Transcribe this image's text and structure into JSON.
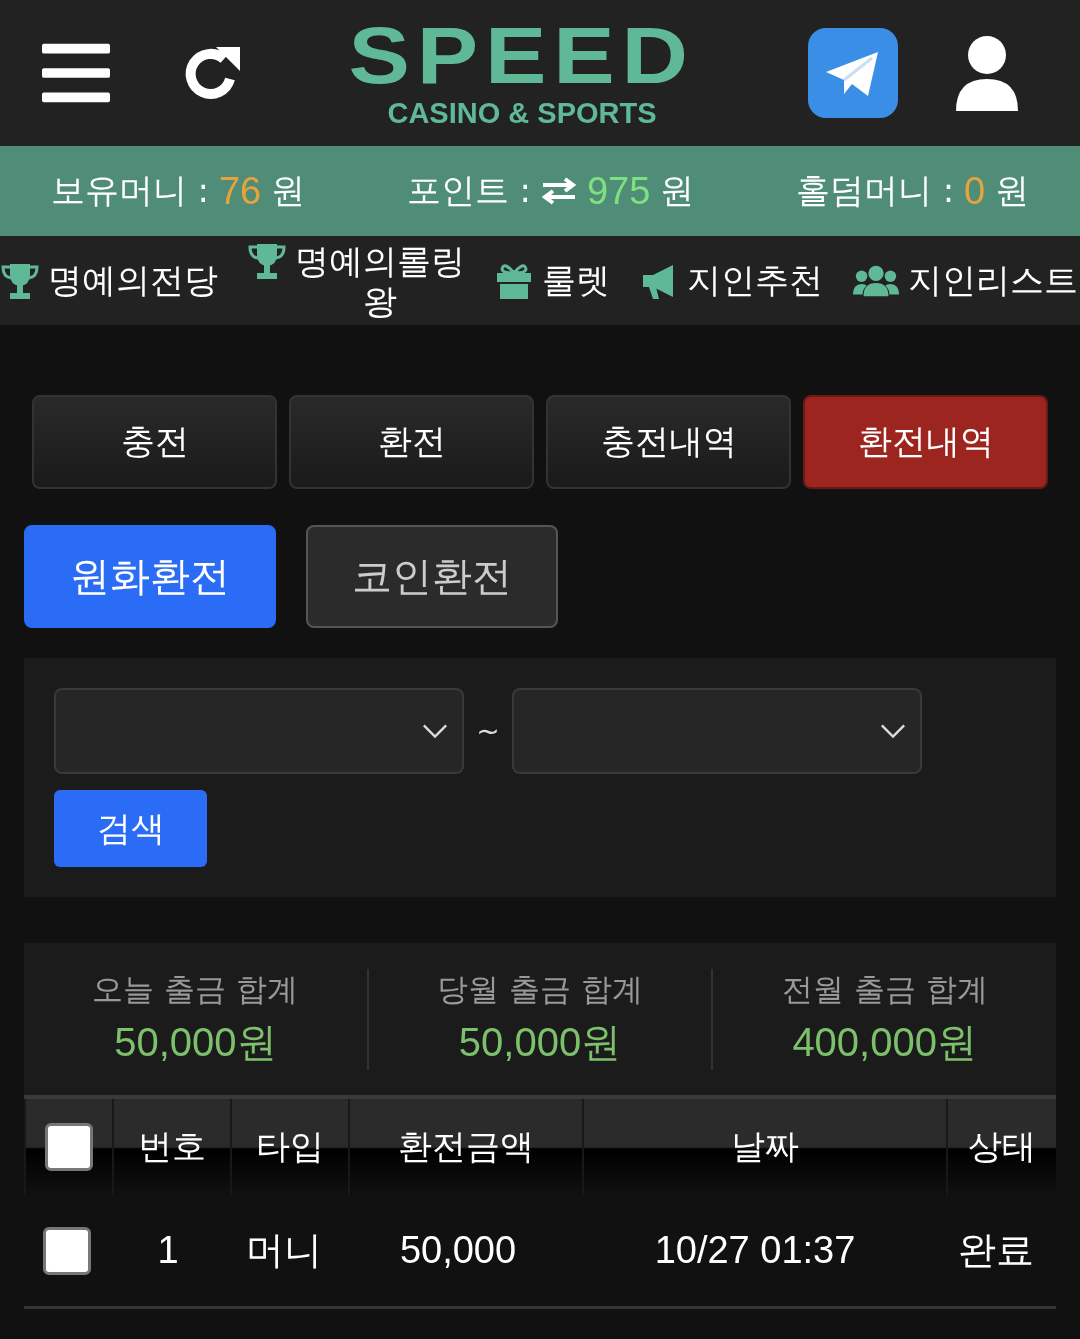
{
  "header": {
    "logo_title": "SPEED",
    "logo_subtitle": "CASINO & SPORTS"
  },
  "balances": [
    {
      "label": "보유머니 :",
      "value": "76",
      "unit": "원",
      "color": "#e6a23c",
      "kind": "plain"
    },
    {
      "label": "포인트 :",
      "value": "975",
      "unit": "원",
      "color": "#7ee07e",
      "kind": "exchange"
    },
    {
      "label": "홀덤머니 :",
      "value": "0",
      "unit": "원",
      "color": "#e6a23c",
      "kind": "plain"
    }
  ],
  "nav": [
    {
      "label": "명예의전당",
      "kind": "trophy"
    },
    {
      "label": "명예의롤링왕",
      "kind": "trophy"
    },
    {
      "label": "룰렛",
      "kind": "gift"
    },
    {
      "label": "지인추천",
      "kind": "megaphone"
    },
    {
      "label": "지인리스트",
      "kind": "users"
    }
  ],
  "tabs": [
    {
      "label": "충전",
      "selected": false
    },
    {
      "label": "환전",
      "selected": false
    },
    {
      "label": "충전내역",
      "selected": false
    },
    {
      "label": "환전내역",
      "selected": true
    }
  ],
  "subtabs": [
    {
      "label": "원화환전",
      "selected": true
    },
    {
      "label": "코인환전",
      "selected": false
    }
  ],
  "filter": {
    "separator": "~",
    "search_button": "검색"
  },
  "summary": [
    {
      "label": "오늘 출금 합계",
      "value": "50,000원"
    },
    {
      "label": "당월 출금 합계",
      "value": "50,000원"
    },
    {
      "label": "전월 출금 합계",
      "value": "400,000원"
    }
  ],
  "table": {
    "header_checked": false,
    "columns": [
      "번호",
      "타입",
      "환전금액",
      "날짜",
      "상태"
    ],
    "rows": [
      {
        "checked": false,
        "cells": [
          "1",
          "머니",
          "50,000",
          "10/27 01:37",
          "완료"
        ]
      }
    ]
  }
}
